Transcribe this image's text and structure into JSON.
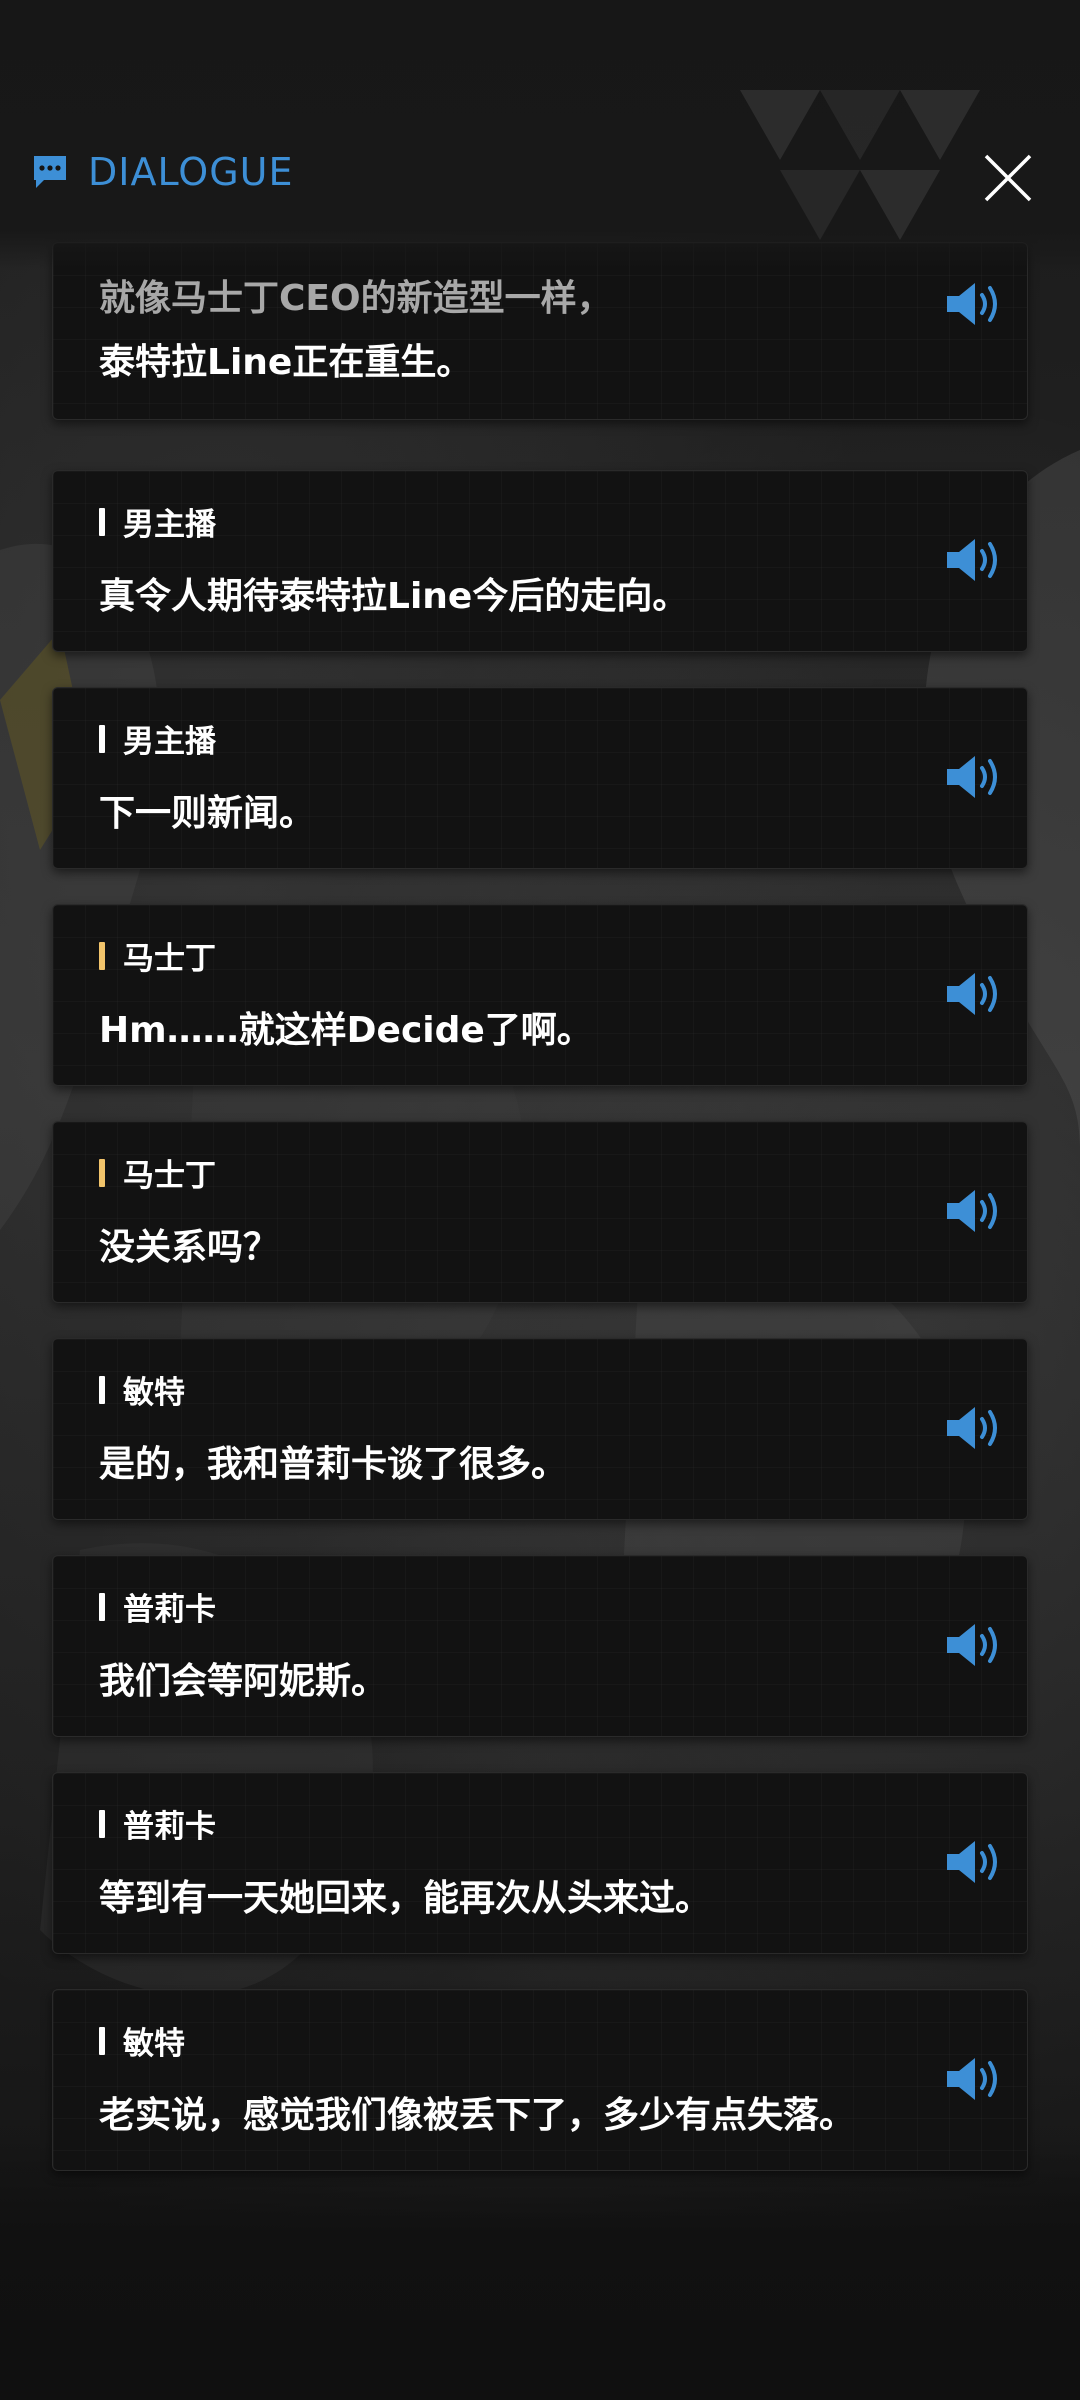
{
  "header": {
    "title": "DIALOGUE",
    "title_icon": "chat-bubble-icon",
    "close_icon": "close-icon",
    "accent_color": "#3d8fd6"
  },
  "colors": {
    "audio_icon": "#3d8fd6",
    "speaker_bar_default": "#ffffff",
    "speaker_bar_highlight": "#f2c46b",
    "card_background": "#121212"
  },
  "first_entry": {
    "line1": "就像马士丁CEO的新造型一样，",
    "line2": "泰特拉Line正在重生。",
    "audio_icon": "speaker-volume-icon"
  },
  "entries": [
    {
      "speaker": "男主播",
      "text": "真令人期待泰特拉Line今后的走向。",
      "bar": "default"
    },
    {
      "speaker": "男主播",
      "text": "下一则新闻。",
      "bar": "default"
    },
    {
      "speaker": "马士丁",
      "text": "Hm……就这样Decide了啊。",
      "bar": "highlight"
    },
    {
      "speaker": "马士丁",
      "text": "没关系吗？",
      "bar": "highlight"
    },
    {
      "speaker": "敏特",
      "text": "是的，我和普莉卡谈了很多。",
      "bar": "default"
    },
    {
      "speaker": "普莉卡",
      "text": "我们会等阿妮斯。",
      "bar": "default"
    },
    {
      "speaker": "普莉卡",
      "text": "等到有一天她回来，能再次从头来过。",
      "bar": "default"
    },
    {
      "speaker": "敏特",
      "text": "老实说，感觉我们像被丢下了，多少有点失落。",
      "bar": "default"
    }
  ]
}
